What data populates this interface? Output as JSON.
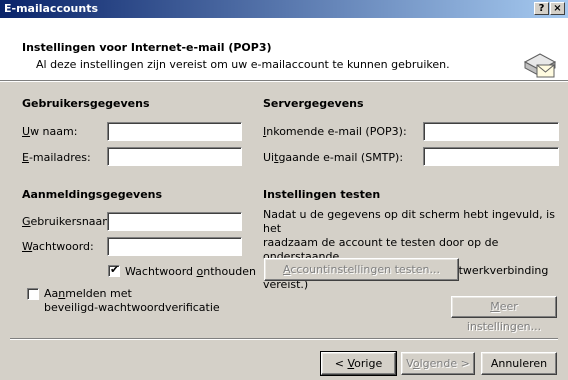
{
  "window": {
    "title": "E-mailaccounts",
    "help_button": "?",
    "close_button": "×"
  },
  "header": {
    "title": "Instellingen voor Internet-e-mail (POP3)",
    "subtitle": "Al deze instellingen zijn vereist om uw e-mailaccount te kunnen gebruiken.",
    "icon": "mail-settings-icon"
  },
  "user_info": {
    "heading": "Gebruikersgegevens",
    "name_label_u": "U",
    "name_label_rest": "w naam:",
    "name_value": "",
    "email_label_u": "E",
    "email_label_rest": "-mailadres:",
    "email_value": ""
  },
  "server_info": {
    "heading": "Servergegevens",
    "incoming_label_u": "I",
    "incoming_label_rest": "nkomende e-mail (POP3):",
    "incoming_value": "",
    "outgoing_label_a": "Ui",
    "outgoing_label_u": "t",
    "outgoing_label_rest": "gaande e-mail (SMTP):",
    "outgoing_value": ""
  },
  "logon_info": {
    "heading": "Aanmeldingsgegevens",
    "username_label_u": "G",
    "username_label_rest": "ebruikersnaam:",
    "username_value": "",
    "password_label_u": "W",
    "password_label_rest": "achtwoord:",
    "password_value": "",
    "remember_checked": true,
    "remember_label_a": "Wachtwoord ",
    "remember_label_u": "o",
    "remember_label_rest": "nthouden",
    "spa_checked": false,
    "spa_label_a": "Aa",
    "spa_label_u": "n",
    "spa_label_rest": "melden met",
    "spa_label_line2": "beveiligd-wachtwoordverificatie"
  },
  "test_settings": {
    "heading": "Instellingen testen",
    "description_line1": "Nadat u de gegevens op dit scherm hebt ingevuld, is het",
    "description_line2": "raadzaam de account te testen door op de onderstaande",
    "description_line3": "knop te klikken. (Hiervoor is een netwerkverbinding vereist.)",
    "test_button_u": "A",
    "test_button_rest": "ccountinstellingen testen..."
  },
  "more_settings": {
    "label_u": "M",
    "label_rest": "eer instellingen..."
  },
  "footer": {
    "back_prefix": "< ",
    "back_u": "V",
    "back_rest": "orige",
    "next_a": "V",
    "next_u": "o",
    "next_rest": "lgende >",
    "cancel_label": "Annuleren"
  }
}
